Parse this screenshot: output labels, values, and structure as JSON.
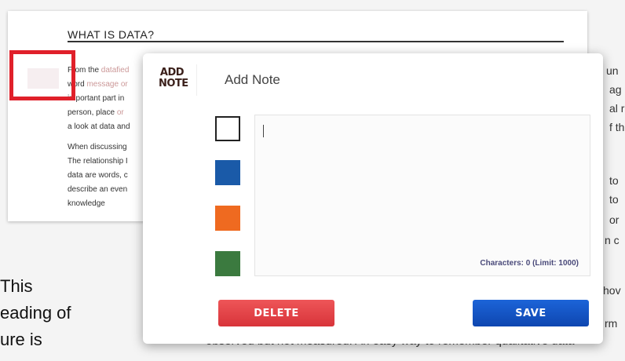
{
  "background_page": {
    "heading": "WHAT IS DATA?",
    "paragraph1": [
      {
        "text": "From the",
        "faded": "datafied"
      },
      {
        "text": "word",
        "faded": "message or"
      },
      {
        "text": "important part in",
        "faded": ""
      },
      {
        "text": "person, place",
        "faded": "or"
      },
      {
        "text": "a look at data and",
        "faded": ""
      }
    ],
    "paragraph2": [
      "When discussing",
      "The relationship I",
      "data are words, c",
      "describe an even",
      "knowledge"
    ],
    "right_edge": [
      "un",
      "ag",
      "al r",
      "f th",
      "to",
      "to",
      "or",
      "n c",
      "hov",
      "rm"
    ],
    "left_edge": [
      "This",
      "eading of",
      "ure is"
    ],
    "bottom_line": "observed but not measured. An easy way to remember qualitative data"
  },
  "dialog": {
    "logo_line1": "ADD",
    "logo_line2": "NOTE",
    "title": "Add Note",
    "colors": [
      {
        "name": "white",
        "hex": "#ffffff",
        "selected": true
      },
      {
        "name": "blue",
        "hex": "#1a5aa8",
        "selected": false
      },
      {
        "name": "orange",
        "hex": "#ef6a20",
        "selected": false
      },
      {
        "name": "green",
        "hex": "#3b7a3f",
        "selected": false
      }
    ],
    "note_value": "",
    "char_count_label": "Characters: 0 (Limit: 1000)",
    "delete_label": "DELETE",
    "save_label": "SAVE"
  },
  "accent_colors": {
    "delete": "#e0443f",
    "save": "#1452c4",
    "highlight": "#e0202a"
  }
}
